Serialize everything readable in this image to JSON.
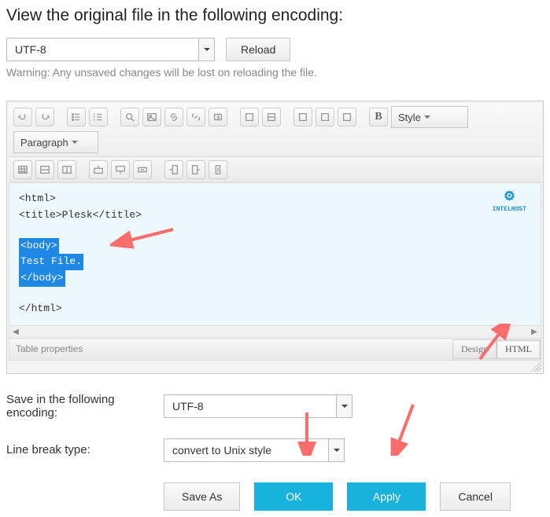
{
  "heading": "View the original file in the following encoding:",
  "encoding_select": {
    "value": "UTF-8"
  },
  "reload_label": "Reload",
  "warning_text": "Warning: Any unsaved changes will be lost on reloading the file.",
  "toolbar": {
    "bold_glyph": "B",
    "style_label": "Style",
    "paragraph_label": "Paragraph"
  },
  "logo_text": "INTELHOST",
  "code": {
    "l1": "<html>",
    "l2": "<title>Plesk</title>",
    "l3": "<body>",
    "l4": "Test File.",
    "l5": "</body>",
    "l6": "</html>"
  },
  "statusbar_text": "Table properties",
  "view_tabs": {
    "design": "Design",
    "html": "HTML"
  },
  "save_encoding": {
    "label": "Save in the following encoding:",
    "value": "UTF-8"
  },
  "line_break": {
    "label": "Line break type:",
    "value": "convert to Unix style"
  },
  "buttons": {
    "save_as": "Save As",
    "ok": "OK",
    "apply": "Apply",
    "cancel": "Cancel"
  }
}
